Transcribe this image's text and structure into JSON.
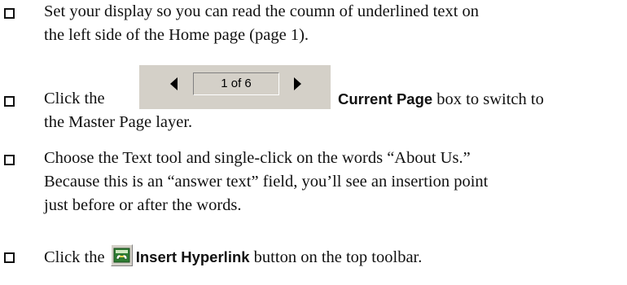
{
  "steps": [
    {
      "line1": "Set your display so you can read the coumn of underlined text on",
      "line2": "the left side of the Home page (page 1)."
    },
    {
      "before": "Click the",
      "label": "Current Page",
      "after": " box to switch to",
      "line2": "the Master Page layer.",
      "pager": {
        "value": "1 of 6",
        "prev_icon": "left-triangle-arrow",
        "next_icon": "right-triangle-arrow"
      }
    },
    {
      "line1": "Choose the Text tool and single-click on the words “About Us.”",
      "line2": "Because this is an “answer text” field, you’ll see an insertion point",
      "line3": "just before or after the words."
    },
    {
      "before": "Click the",
      "label": "Insert Hyperlink",
      "after": " button on the top toolbar.",
      "icon": "insert-hyperlink-icon"
    }
  ],
  "colors": {
    "text": "#111111",
    "widget_face": "#d4d0c8",
    "hyperlink_icon": "#2e7d32"
  }
}
